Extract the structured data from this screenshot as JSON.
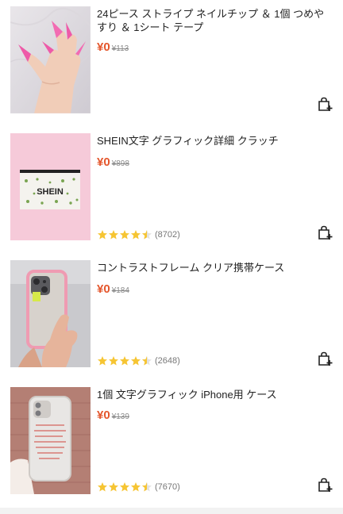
{
  "products": [
    {
      "title": "24ピース ストライプ ネイルチップ ＆ 1個 つめやすり ＆ 1シート テープ",
      "price": "¥0",
      "original_price": "¥113",
      "rating": null,
      "review_count": ""
    },
    {
      "title": "SHEIN文字 グラフィック詳細 クラッチ",
      "price": "¥0",
      "original_price": "¥898",
      "rating": 4.5,
      "review_count": "(8702)",
      "image_text": "SHEIN"
    },
    {
      "title": "コントラストフレーム クリア携帯ケース",
      "price": "¥0",
      "original_price": "¥184",
      "rating": 4.5,
      "review_count": "(2648)"
    },
    {
      "title": "1個 文字グラフィック iPhone用 ケース",
      "price": "¥0",
      "original_price": "¥139",
      "rating": 4.5,
      "review_count": "(7670)"
    }
  ],
  "icons": {
    "cart": "add-to-cart-icon",
    "star": "star-icon"
  },
  "colors": {
    "price": "#e4562c",
    "star": "#f6c533"
  }
}
